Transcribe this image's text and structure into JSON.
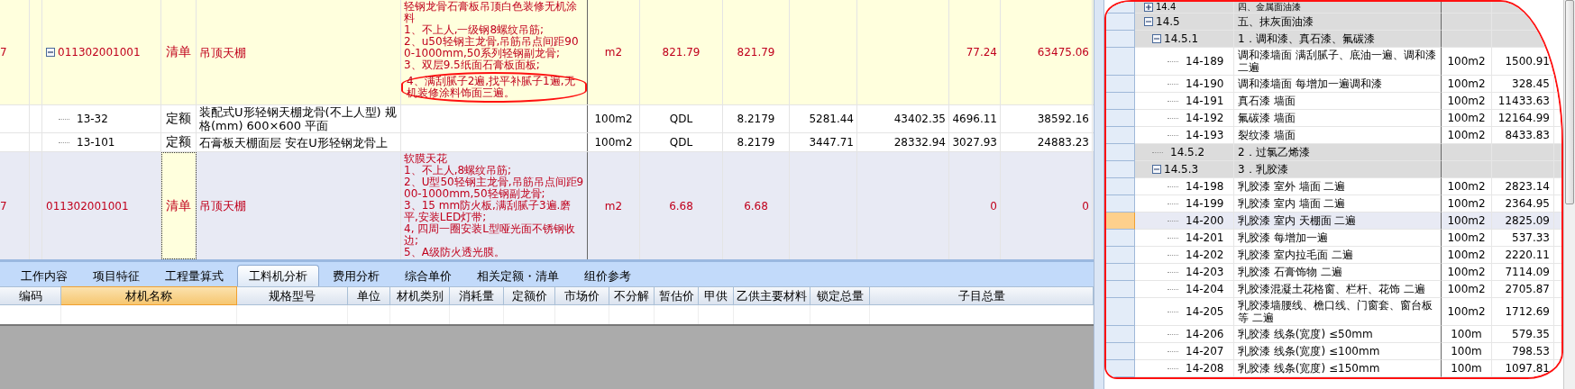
{
  "main_table": {
    "rows": [
      {
        "column_1": "7",
        "code": "011302001001",
        "expanded": true,
        "type": "清单",
        "kind": "bill",
        "name": "吊顶天棚",
        "selected": false,
        "features": [
          {
            "text": "轻钢龙骨石膏板吊顶白色装修无机涂料",
            "circled": false
          },
          {
            "text": "1、不上人,一级钢8螺纹吊筋;",
            "circled": false
          },
          {
            "text": "2、u50轻钢主龙骨,吊筋吊点间距900-1000mm,50系列轻钢副龙骨;",
            "circled": false
          },
          {
            "text": "3、双层9.5纸面石膏板面板;",
            "circled": false
          },
          {
            "text": "4、满刮腻子2遍,找平补腻子1遍,无机装修涂料饰面三遍。",
            "circled": true
          }
        ],
        "column_7": "m2",
        "column_8": "821.79",
        "column_9": "821.79",
        "column_12": "77.24",
        "column_13": "63475.06",
        "children": [
          {
            "code": "13-32",
            "type": "定额",
            "kind": "quota",
            "name": "装配式U形轻钢天棚龙骨(不上人型) 规格(mm) 600×600 平面",
            "selected": false,
            "column_7": "100m2",
            "column_8": "QDL",
            "column_9": "8.2179",
            "column_10": "5281.44",
            "column_11": "43402.35",
            "column_12": "4696.11",
            "column_13": "38592.16"
          },
          {
            "code": "13-101",
            "type": "定额",
            "kind": "quota",
            "name": "石膏板天棚面层 安在U形轻钢龙骨上",
            "selected": false,
            "column_7": "100m2",
            "column_8": "QDL",
            "column_9": "8.2179",
            "column_10": "3447.71",
            "column_11": "28332.94",
            "column_12": "3027.93",
            "column_13": "24883.23"
          }
        ]
      },
      {
        "column_1": "7",
        "code": "011302001001",
        "type": "清单",
        "kind": "bill",
        "name": "吊顶天棚",
        "selected": true,
        "features": [
          {
            "text": "软膜天花",
            "circled": false
          },
          {
            "text": "1、不上人,8螺纹吊筋;",
            "circled": false
          },
          {
            "text": "2、U型50轻钢主龙骨,吊筋吊点间距900-1000mm,50轻钢副龙骨;",
            "circled": false
          },
          {
            "text": "3、15 mm防火板,满刮腻子3遍.磨平,安装LED灯带;",
            "circled": false
          },
          {
            "text": "4, 四周一圈安装L型哑光面不锈钢收边;",
            "circled": false
          },
          {
            "text": "5、A级防火透光膜。",
            "circled": false
          }
        ],
        "column_7": "m2",
        "column_8": "6.68",
        "column_9": "6.68",
        "column_12": "0",
        "column_13": "0"
      }
    ]
  },
  "bottom_tabs": [
    {
      "label": "工作内容",
      "selected": false
    },
    {
      "label": "项目特征",
      "selected": false
    },
    {
      "label": "工程量算式",
      "selected": false
    },
    {
      "label": "工料机分析",
      "selected": true
    },
    {
      "label": "费用分析",
      "selected": false
    },
    {
      "label": "综合单价",
      "selected": false
    },
    {
      "label": "相关定额・清单",
      "selected": false
    },
    {
      "label": "组价参考",
      "selected": false
    }
  ],
  "material_table": {
    "columns": [
      {
        "label": "编码",
        "selected": false
      },
      {
        "label": "材机名称",
        "selected": true
      },
      {
        "label": "规格型号",
        "selected": false
      },
      {
        "label": "单位",
        "selected": false
      },
      {
        "label": "材机类别",
        "selected": false
      },
      {
        "label": "消耗量",
        "selected": false
      },
      {
        "label": "定额价",
        "selected": false
      },
      {
        "label": "市场价",
        "selected": false
      },
      {
        "label": "不分解",
        "selected": false
      },
      {
        "label": "暂估价",
        "selected": false
      },
      {
        "label": "甲供",
        "selected": false
      },
      {
        "label": "乙供主要材料",
        "selected": false
      },
      {
        "label": "锁定总量",
        "selected": false
      },
      {
        "label": "子目总量",
        "selected": false
      }
    ]
  },
  "quota_tree": [
    {
      "kind": "section",
      "code": "14.4",
      "name": "四、金属面油漆",
      "expanded": false,
      "selected": false
    },
    {
      "kind": "section",
      "code": "14.5",
      "name": "五、抹灰面油漆",
      "expanded": true,
      "selected": false,
      "children": [
        {
          "kind": "section",
          "code": "14.5.1",
          "name": "1．调和漆、真石漆、氟碳漆",
          "expanded": true,
          "selected": false,
          "children": [
            {
              "kind": "item",
              "code": "14-189",
              "name": "调和漆墙面 满刮腻子、底油一遍、调和漆二遍",
              "unit": "100m2",
              "price": "1500.91",
              "selected": false
            },
            {
              "kind": "item",
              "code": "14-190",
              "name": "调和漆墙面 每增加一遍调和漆",
              "unit": "100m2",
              "price": "328.45",
              "selected": false
            },
            {
              "kind": "item",
              "code": "14-191",
              "name": "真石漆 墙面",
              "unit": "100m2",
              "price": "11433.63",
              "selected": false
            },
            {
              "kind": "item",
              "code": "14-192",
              "name": "氟碳漆 墙面",
              "unit": "100m2",
              "price": "12164.99",
              "selected": false
            },
            {
              "kind": "item",
              "code": "14-193",
              "name": "裂纹漆 墙面",
              "unit": "100m2",
              "price": "8433.83",
              "selected": false
            }
          ]
        },
        {
          "kind": "section",
          "code": "14.5.2",
          "name": "2．过氯乙烯漆",
          "selected": false
        },
        {
          "kind": "section",
          "code": "14.5.3",
          "name": "3．乳胶漆",
          "expanded": true,
          "selected": false,
          "children": [
            {
              "kind": "item",
              "code": "14-198",
              "name": "乳胶漆 室外 墙面 二遍",
              "unit": "100m2",
              "price": "2823.14",
              "selected": false
            },
            {
              "kind": "item",
              "code": "14-199",
              "name": "乳胶漆 室内 墙面 二遍",
              "unit": "100m2",
              "price": "2364.95",
              "selected": false
            },
            {
              "kind": "item",
              "code": "14-200",
              "name": "乳胶漆 室内 天棚面 二遍",
              "unit": "100m2",
              "price": "2825.09",
              "selected": true
            },
            {
              "kind": "item",
              "code": "14-201",
              "name": "乳胶漆 每增加一遍",
              "unit": "100m2",
              "price": "537.33",
              "selected": false
            },
            {
              "kind": "item",
              "code": "14-202",
              "name": "乳胶漆 室内拉毛面 二遍",
              "unit": "100m2",
              "price": "2220.11",
              "selected": false
            },
            {
              "kind": "item",
              "code": "14-203",
              "name": "乳胶漆 石膏饰物 二遍",
              "unit": "100m2",
              "price": "7114.09",
              "selected": false
            },
            {
              "kind": "item",
              "code": "14-204",
              "name": "乳胶漆混凝土花格窗、栏杆、花饰 二遍",
              "unit": "100m2",
              "price": "2705.87",
              "selected": false
            },
            {
              "kind": "item",
              "code": "14-205",
              "name": "乳胶漆墙腰线、檐口线、门窗套、窗台板等 二遍",
              "unit": "100m2",
              "price": "1712.69",
              "selected": false
            },
            {
              "kind": "item",
              "code": "14-206",
              "name": "乳胶漆  线条(宽度) ≤50mm",
              "unit": "100m",
              "price": "579.35",
              "selected": false
            },
            {
              "kind": "item",
              "code": "14-207",
              "name": "乳胶漆  线条(宽度) ≤100mm",
              "unit": "100m",
              "price": "798.53",
              "selected": false
            },
            {
              "kind": "item",
              "code": "14-208",
              "name": "乳胶漆  线条(宽度) ≤150mm",
              "unit": "100m",
              "price": "1097.81",
              "selected": false
            }
          ]
        }
      ]
    }
  ]
}
